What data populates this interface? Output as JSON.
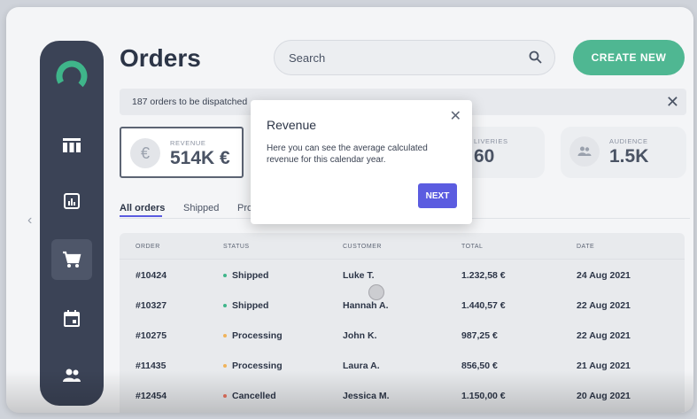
{
  "page": {
    "title": "Orders"
  },
  "search": {
    "placeholder": "Search"
  },
  "actions": {
    "create_label": "CREATE NEW"
  },
  "notice": {
    "text": "187 orders to be dispatched"
  },
  "cards": [
    {
      "label": "REVENUE",
      "value": "514K €",
      "icon": "euro-icon"
    },
    {
      "label": "DELIVERIES",
      "label_visible": "LIVERIES",
      "value": "60"
    },
    {
      "label": "AUDIENCE",
      "value": "1.5K",
      "icon": "people-icon"
    }
  ],
  "tabs": [
    "All orders",
    "Shipped",
    "Pro"
  ],
  "table": {
    "headers": [
      "ORDER",
      "STATUS",
      "CUSTOMER",
      "TOTAL",
      "DATE"
    ],
    "rows": [
      {
        "order": "#10424",
        "status": "Shipped",
        "customer": "Luke T.",
        "total": "1.232,58 €",
        "date": "24 Aug 2021"
      },
      {
        "order": "#10327",
        "status": "Shipped",
        "customer": "Hannah A.",
        "total": "1.440,57 €",
        "date": "22 Aug 2021"
      },
      {
        "order": "#10275",
        "status": "Processing",
        "customer": "John K.",
        "total": "987,25 €",
        "date": "22 Aug 2021"
      },
      {
        "order": "#11435",
        "status": "Processing",
        "customer": "Laura A.",
        "total": "856,50 €",
        "date": "21 Aug 2021"
      },
      {
        "order": "#12454",
        "status": "Cancelled",
        "customer": "Jessica M.",
        "total": "1.150,00 €",
        "date": "20 Aug 2021"
      }
    ]
  },
  "popover": {
    "title": "Revenue",
    "body": "Here you can see the average calculated revenue for this calendar year.",
    "next_label": "NEXT"
  },
  "colors": {
    "sidebar": "#3b4356",
    "accent_green": "#4fb792",
    "accent_purple": "#5b5ce0",
    "status_shipped": "#3fb58a",
    "status_processing": "#f0b35b",
    "status_cancelled": "#e8735f"
  }
}
